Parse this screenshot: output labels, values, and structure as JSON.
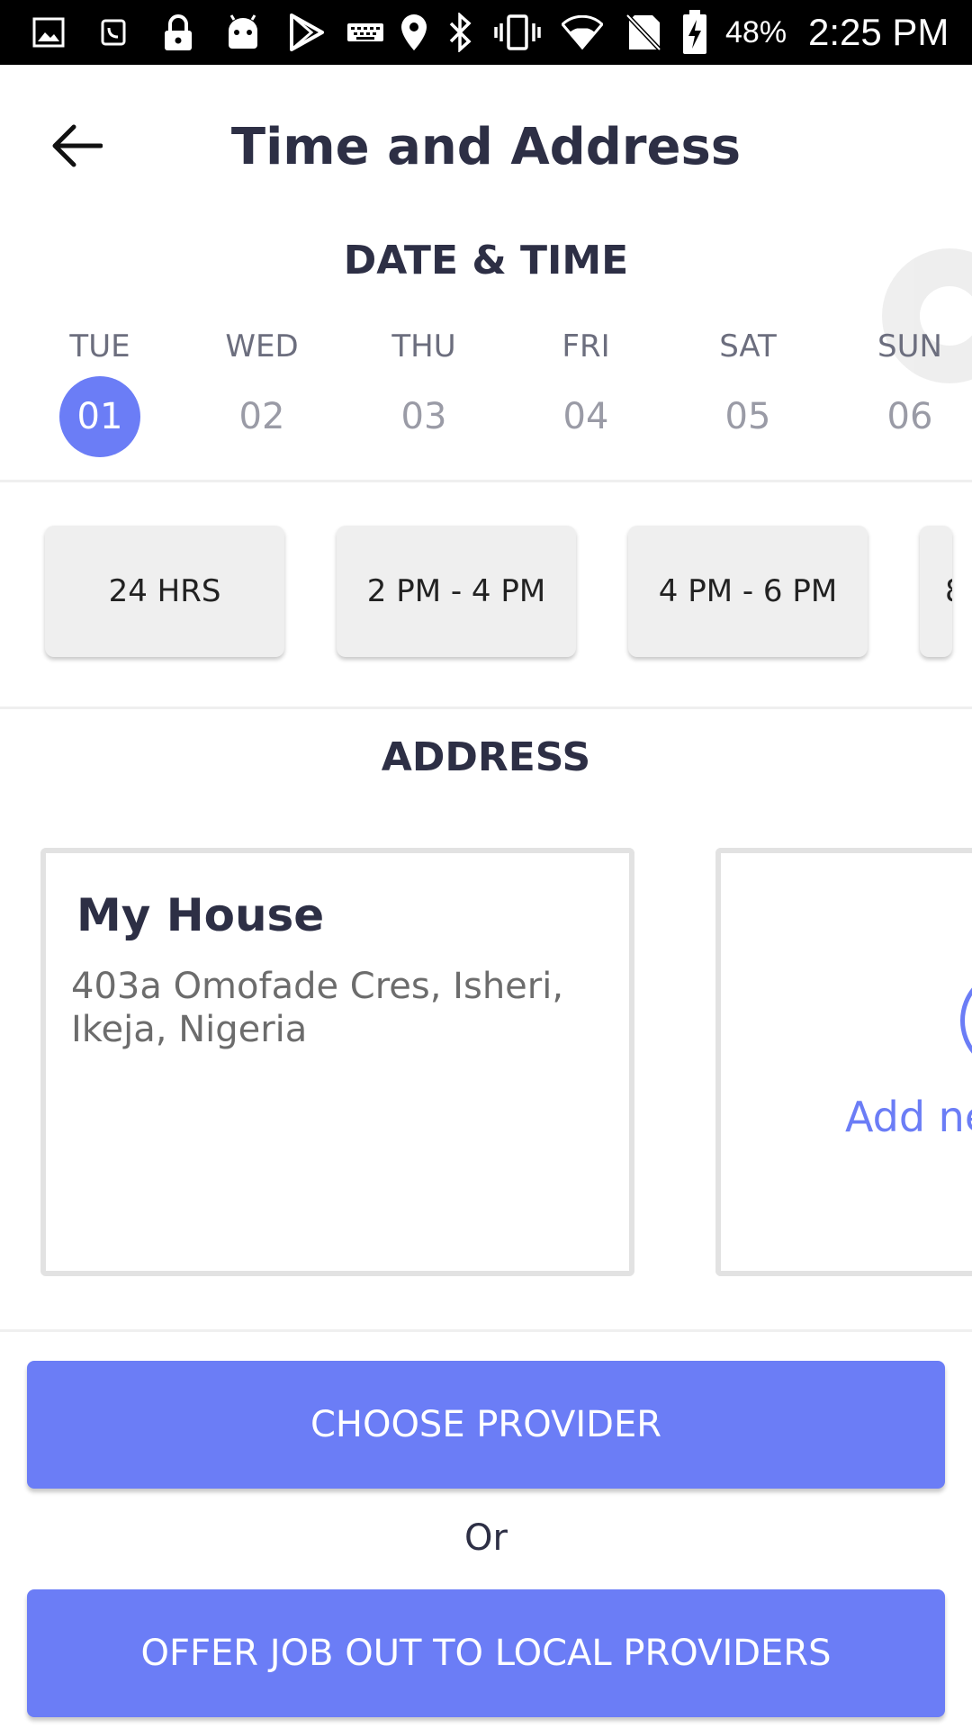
{
  "status_bar": {
    "battery_percent": "48%",
    "time": "2:25 PM",
    "icons": [
      "image-icon",
      "phone-card-icon",
      "lock-icon",
      "android-icon",
      "play-store-icon",
      "keyboard-icon",
      "location-icon",
      "bluetooth-icon",
      "vibrate-icon",
      "wifi-icon",
      "no-sim-icon",
      "battery-charging-icon"
    ]
  },
  "header": {
    "title": "Time and Address",
    "back_icon": "arrow-left-icon"
  },
  "date_time": {
    "section_title": "DATE & TIME",
    "days": [
      {
        "dow": "TUE",
        "date": "01",
        "selected": true
      },
      {
        "dow": "WED",
        "date": "02",
        "selected": false
      },
      {
        "dow": "THU",
        "date": "03",
        "selected": false
      },
      {
        "dow": "FRI",
        "date": "04",
        "selected": false
      },
      {
        "dow": "SAT",
        "date": "05",
        "selected": false
      },
      {
        "dow": "SUN",
        "date": "06",
        "selected": false
      }
    ],
    "time_slots": [
      "24 HRS",
      "2 PM - 4 PM",
      "4 PM - 6 PM",
      "8"
    ]
  },
  "address": {
    "section_title": "ADDRESS",
    "cards": [
      {
        "name": "My House",
        "line": "403a Omofade Cres, Isheri, Ikeja, Nigeria"
      }
    ],
    "add_new_label": "Add ne"
  },
  "actions": {
    "choose_provider": "CHOOSE PROVIDER",
    "or": "Or",
    "offer_job": "OFFER JOB OUT TO LOCAL PROVIDERS"
  },
  "colors": {
    "accent": "#6b7df6",
    "text_dark": "#2d2f45",
    "status_bar": "#000000"
  }
}
